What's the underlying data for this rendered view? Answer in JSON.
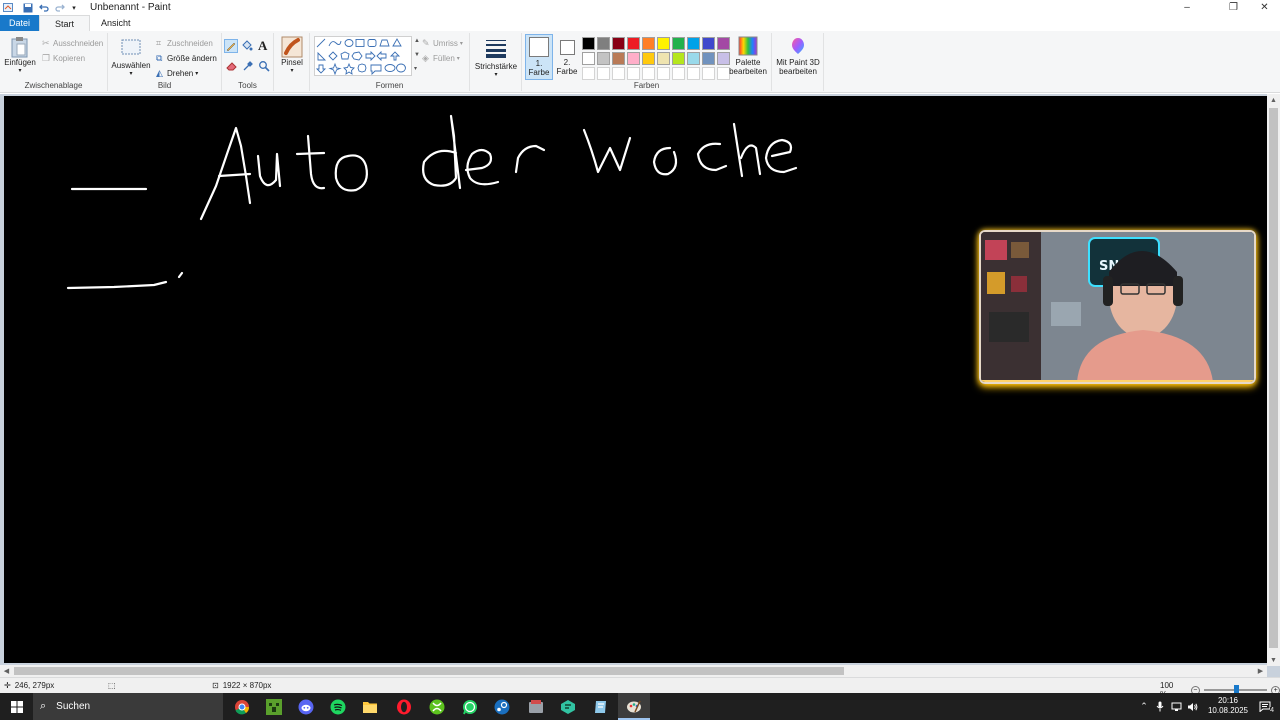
{
  "window": {
    "title": "Unbenannt - Paint",
    "controls": [
      "–",
      "❐",
      "✕"
    ]
  },
  "tabs": [
    {
      "label": "Datei"
    },
    {
      "label": "Start"
    },
    {
      "label": "Ansicht"
    }
  ],
  "ribbon": {
    "clipboard": {
      "label": "Zwischenablage",
      "paste": "Einfügen",
      "cut": "Ausschneiden",
      "copy": "Kopieren"
    },
    "image": {
      "label": "Bild",
      "select": "Auswählen",
      "crop": "Zuschneiden",
      "resize": "Größe ändern",
      "rotate": "Drehen"
    },
    "tools": {
      "label": "Tools"
    },
    "brushes": {
      "label": "Pinsel"
    },
    "shapes": {
      "label": "Formen",
      "outline": "Umriss",
      "fill": "Füllen"
    },
    "size": {
      "label": "Strichstärke"
    },
    "colors": {
      "label": "Farben",
      "color1_line1": "1.",
      "color1_line2": "Farbe",
      "color2_line1": "2.",
      "color2_line2": "Farbe",
      "edit_line1": "Palette",
      "edit_line2": "bearbeiten",
      "palette_row1": [
        "#000000",
        "#7f7f7f",
        "#880015",
        "#ed1c24",
        "#ff7f27",
        "#fff200",
        "#22b14c",
        "#00a2e8",
        "#3f48cc",
        "#a349a4"
      ],
      "palette_row2": [
        "#ffffff",
        "#c3c3c3",
        "#b97a57",
        "#ffaec9",
        "#ffc90e",
        "#efe4b0",
        "#b5e61d",
        "#99d9ea",
        "#7092be",
        "#c8bfe7"
      ]
    },
    "paint3d": {
      "line1": "Mit Paint 3D",
      "line2": "bearbeiten"
    }
  },
  "canvas": {
    "background": "#000000",
    "stroke_color": "#ffffff"
  },
  "statusbar": {
    "cursor_pos": "246, 279px",
    "canvas_size": "1922 × 870px",
    "zoom": "100 %",
    "zoom_level": 1.0
  },
  "taskbar": {
    "search_label": "Suchen",
    "time": "20:16",
    "date": "10.08.2025",
    "notification_count": "4",
    "apps": [
      "chrome-icon",
      "minecraft-icon",
      "discord-icon",
      "spotify-icon",
      "folder-icon",
      "opera-icon",
      "xbox-icon",
      "whatsapp-icon",
      "steam-icon",
      "app-icon",
      "streamlabs-icon",
      "notes-icon",
      "paint-icon"
    ]
  }
}
